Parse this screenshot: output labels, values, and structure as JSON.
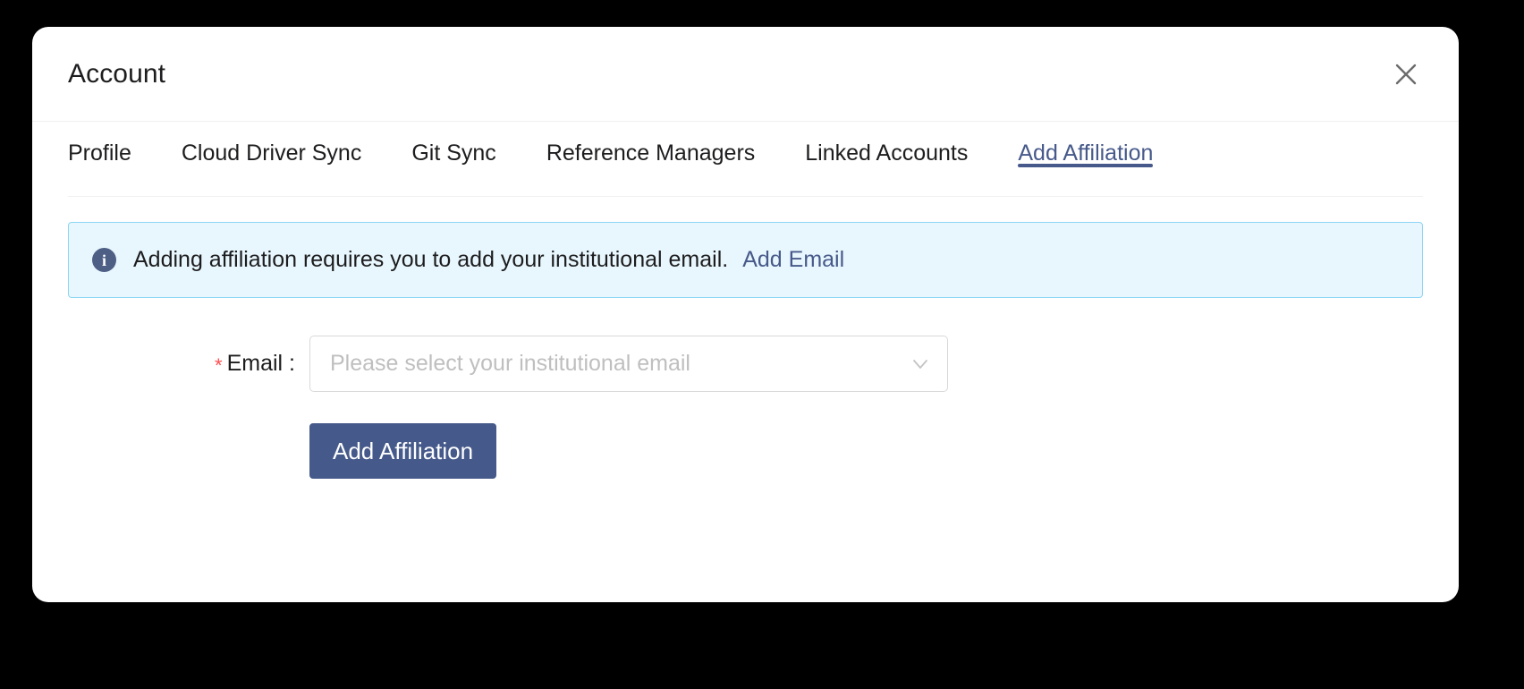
{
  "window": {
    "title": "Account",
    "close_icon": "close-icon"
  },
  "tabs": [
    {
      "label": "Profile",
      "active": false
    },
    {
      "label": "Cloud Driver Sync",
      "active": false
    },
    {
      "label": "Git Sync",
      "active": false
    },
    {
      "label": "Reference Managers",
      "active": false
    },
    {
      "label": "Linked Accounts",
      "active": false
    },
    {
      "label": "Add Affiliation",
      "active": true
    }
  ],
  "banner": {
    "icon": "info-circle-icon",
    "message": "Adding affiliation requires you to add your institutional email.",
    "link_label": "Add Email",
    "background": "#e8f7fd",
    "border": "#8ed5f5",
    "icon_color": "#4e5f86",
    "link_color": "#46598a"
  },
  "form": {
    "email": {
      "required_marker": "*",
      "label": "Email :",
      "placeholder": "Please select your institutional email",
      "value": "",
      "chevron_icon": "chevron-down-icon"
    },
    "submit_label": "Add Affiliation",
    "submit_color": "#45598a"
  },
  "theme": {
    "accent": "#46598a",
    "page_background": "#000000",
    "card_background": "#ffffff"
  }
}
